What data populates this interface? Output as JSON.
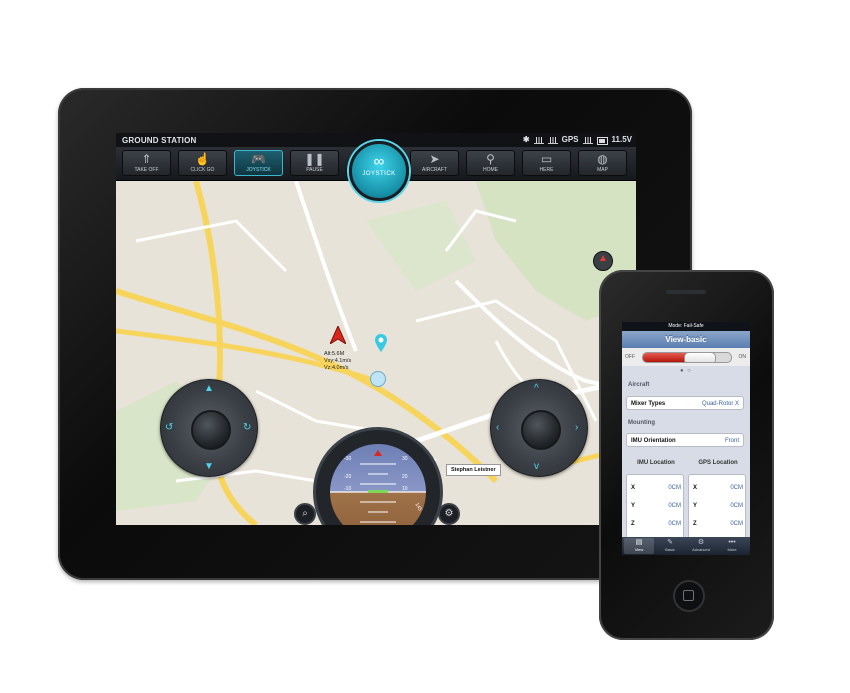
{
  "tablet": {
    "app_title": "GROUND STATION",
    "status": {
      "gps_label": "GPS",
      "battery": "11.5V"
    },
    "toolbar": [
      {
        "label": "TAKE OFF",
        "icon": "takeoff-icon",
        "glyph": "⇑"
      },
      {
        "label": "CLICK GO",
        "icon": "hand-pointer-icon",
        "glyph": "☝"
      },
      {
        "label": "JOYSTICK",
        "icon": "gamepad-icon",
        "glyph": "🎮",
        "active": true
      },
      {
        "label": "PAUSE",
        "icon": "pause-icon",
        "glyph": "❚❚"
      },
      {
        "label": "AIRCRAFT",
        "icon": "paper-plane-icon",
        "glyph": "➤"
      },
      {
        "label": "HOME",
        "icon": "map-pin-icon",
        "glyph": "⚲"
      },
      {
        "label": "HERE",
        "icon": "tablet-icon",
        "glyph": "▭"
      },
      {
        "label": "MAP",
        "icon": "globe-icon",
        "glyph": "◍"
      }
    ],
    "mode_button": {
      "label": "JOYSTICK",
      "icon": "link-icon",
      "glyph": "∞"
    },
    "telemetry": {
      "alt": "Alt:5.6M",
      "vxy": "Vxy:4.1m/s",
      "vz": "Vz:4.0m/s"
    },
    "map_label": "Stephan Leistner",
    "attitude": {
      "pitch_marks": [
        "-30",
        "-20",
        "-10",
        "10",
        "20",
        "30"
      ],
      "heading": "145"
    },
    "colors": {
      "accent": "#39c9e3",
      "marker": "#d9271c"
    }
  },
  "phone": {
    "status_text": "Mode: Fail-Safe",
    "title": "View-basic",
    "switch": {
      "off_label": "OFF",
      "on_label": "ON",
      "level": 0.55
    },
    "sections": {
      "aircraft": "Aircraft",
      "mounting": "Mounting"
    },
    "mixer": {
      "label": "Mixer Types",
      "value": "Quad-Rotor X"
    },
    "imu_orientation": {
      "label": "IMU Orientation",
      "value": "Front"
    },
    "imu_location": {
      "title": "IMU Location",
      "rows": [
        {
          "axis": "X",
          "value": "0CM"
        },
        {
          "axis": "Y",
          "value": "0CM"
        },
        {
          "axis": "Z",
          "value": "0CM"
        }
      ]
    },
    "gps_location": {
      "title": "GPS Location",
      "rows": [
        {
          "axis": "X",
          "value": "0CM"
        },
        {
          "axis": "Y",
          "value": "0CM"
        },
        {
          "axis": "Z",
          "value": "0CM"
        }
      ]
    },
    "tabs": [
      {
        "label": "View",
        "icon": "view-icon",
        "glyph": "▤",
        "active": true
      },
      {
        "label": "Basic",
        "icon": "wrench-icon",
        "glyph": "✎"
      },
      {
        "label": "Advanced",
        "icon": "gear-icon",
        "glyph": "⚙"
      },
      {
        "label": "More",
        "icon": "more-icon",
        "glyph": "•••"
      }
    ]
  }
}
